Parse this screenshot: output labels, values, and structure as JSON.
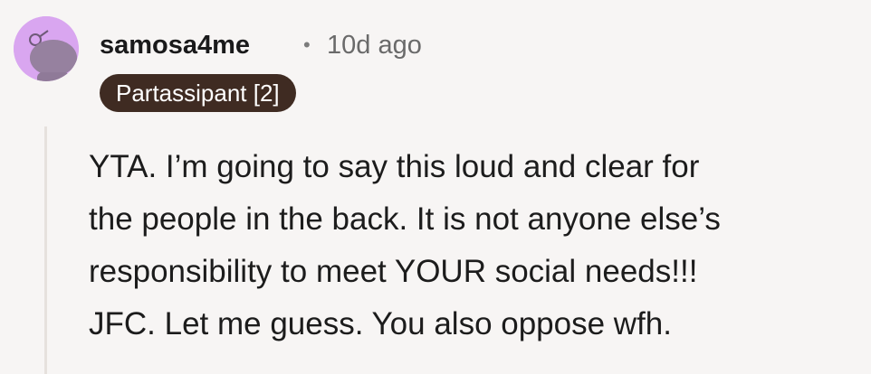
{
  "comment": {
    "username": "samosa4me",
    "separator": "•",
    "timestamp": "10d ago",
    "flair": "Partassipant [2]",
    "avatar_icon": "snoo-avatar-icon",
    "lines": [
      "YTA. I’m going to say this loud and clear for",
      "the people in the back. It is not anyone else’s",
      "responsibility to meet YOUR social needs!!!",
      "JFC. Let me guess. You also oppose wfh."
    ]
  },
  "colors": {
    "background": "#f7f5f4",
    "avatar_bg": "#d9a6f0",
    "flair_bg": "#3f2b22",
    "flair_text": "#ffffff",
    "thread_line": "#e6e1dd"
  }
}
